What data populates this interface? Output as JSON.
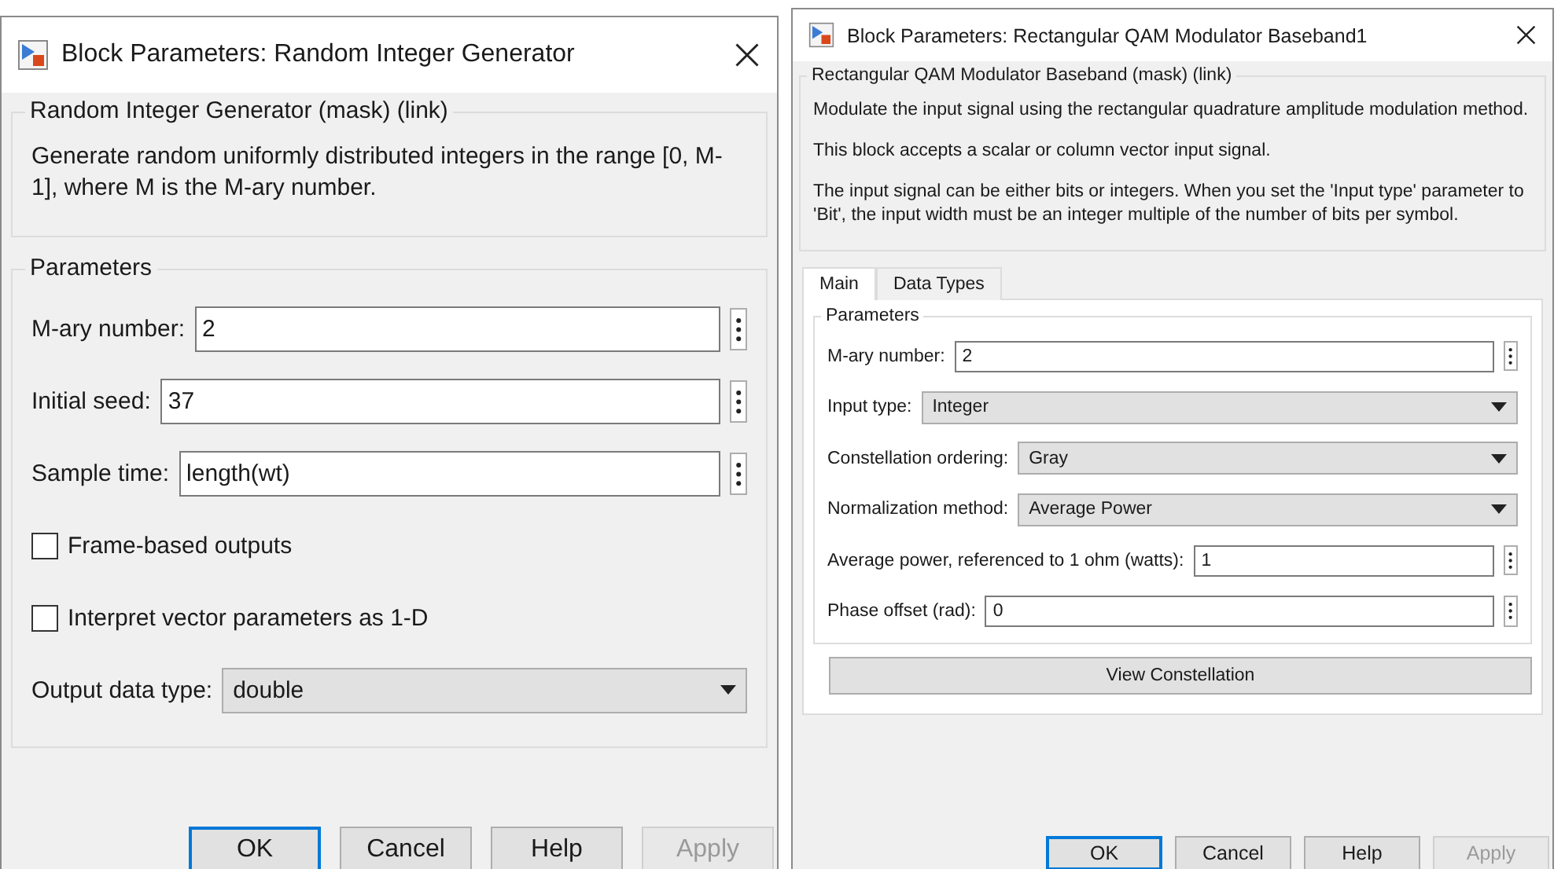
{
  "dialogs": [
    {
      "title": "Block Parameters: Random Integer Generator",
      "mask_title": "Random Integer Generator (mask) (link)",
      "description": [
        "Generate random uniformly distributed integers in the range [0, M-1], where M is the M-ary number."
      ],
      "parameters_title": "Parameters",
      "fields": [
        {
          "kind": "edit",
          "label": "M-ary number:",
          "value": "2"
        },
        {
          "kind": "edit",
          "label": "Initial seed:",
          "value": "37"
        },
        {
          "kind": "edit",
          "label": "Sample time:",
          "value": "length(wt)"
        },
        {
          "kind": "checkbox",
          "label": "Frame-based outputs",
          "checked": false
        },
        {
          "kind": "checkbox",
          "label": "Interpret vector parameters as 1-D",
          "checked": false
        },
        {
          "kind": "dropdown",
          "label": "Output data type:",
          "value": "double"
        }
      ],
      "buttons": [
        {
          "label": "OK",
          "default": true,
          "disabled": false
        },
        {
          "label": "Cancel",
          "default": false,
          "disabled": false
        },
        {
          "label": "Help",
          "default": false,
          "disabled": false
        },
        {
          "label": "Apply",
          "default": false,
          "disabled": true
        }
      ]
    },
    {
      "title": "Block Parameters: Rectangular QAM Modulator Baseband1",
      "mask_title": "Rectangular QAM Modulator Baseband (mask) (link)",
      "description": [
        "Modulate the input signal using the rectangular quadrature amplitude modulation method.",
        "This block accepts a scalar or column vector input signal.",
        "The input signal can be either bits or integers. When you set the 'Input type' parameter to 'Bit', the input width must be an integer multiple of the number of bits per symbol."
      ],
      "tabs": [
        {
          "label": "Main",
          "selected": true
        },
        {
          "label": "Data Types",
          "selected": false
        }
      ],
      "parameters_title": "Parameters",
      "fields": [
        {
          "kind": "edit",
          "label": "M-ary number:",
          "value": "2"
        },
        {
          "kind": "dropdown",
          "label": "Input type:",
          "value": "Integer"
        },
        {
          "kind": "dropdown",
          "label": "Constellation ordering:",
          "value": "Gray"
        },
        {
          "kind": "dropdown",
          "label": "Normalization method:",
          "value": "Average Power"
        },
        {
          "kind": "edit",
          "label": "Average power, referenced to 1 ohm (watts):",
          "value": "1"
        },
        {
          "kind": "edit",
          "label": "Phase offset (rad):",
          "value": "0"
        }
      ],
      "action_button": "View Constellation",
      "buttons": [
        {
          "label": "OK",
          "default": true,
          "disabled": false
        },
        {
          "label": "Cancel",
          "default": false,
          "disabled": false
        },
        {
          "label": "Help",
          "default": false,
          "disabled": false
        },
        {
          "label": "Apply",
          "default": false,
          "disabled": true
        }
      ]
    }
  ]
}
